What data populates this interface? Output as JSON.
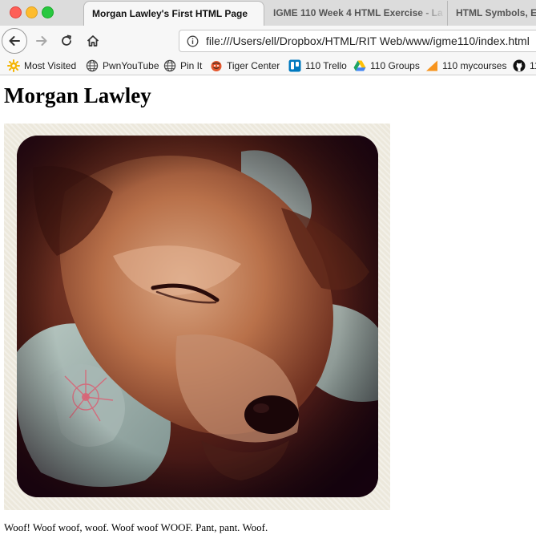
{
  "browser": {
    "tabs": [
      {
        "label": "Morgan Lawley's First HTML Page",
        "active": true
      },
      {
        "label": "IGME 110 Week 4 HTML Exercise - La",
        "active": false
      },
      {
        "label": "HTML Symbols, En",
        "active": false
      }
    ],
    "url": "file:///Users/ell/Dropbox/HTML/RIT Web/www/igme110/index.html",
    "bookmarks": [
      {
        "label": "Most Visited",
        "icon": "gear-icon"
      },
      {
        "label": "PwnYouTube",
        "icon": "globe-icon"
      },
      {
        "label": "Pin It",
        "icon": "globe-icon"
      },
      {
        "label": "Tiger Center",
        "icon": "tiger-icon"
      },
      {
        "label": "110 Trello",
        "icon": "trello-icon"
      },
      {
        "label": "110 Groups",
        "icon": "drive-icon"
      },
      {
        "label": "110 mycourses",
        "icon": "mycourses-icon"
      },
      {
        "label": "11",
        "icon": "github-icon"
      }
    ]
  },
  "page": {
    "heading": "Morgan Lawley",
    "caption": "Woof! Woof woof, woof. Woof woof WOOF. Pant, pant. Woof."
  },
  "colors": {
    "close": "#fe5f57",
    "minimize": "#febc2e",
    "zoom": "#28c840",
    "photo_frame": "#ece8dc"
  }
}
